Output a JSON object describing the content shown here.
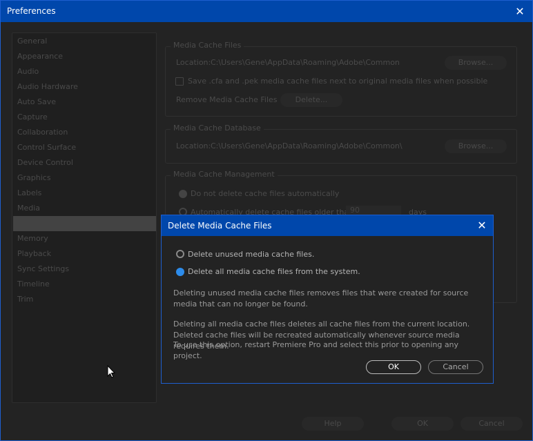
{
  "window": {
    "title": "Preferences"
  },
  "sidebar": {
    "items": [
      "General",
      "Appearance",
      "Audio",
      "Audio Hardware",
      "Auto Save",
      "Capture",
      "Collaboration",
      "Control Surface",
      "Device Control",
      "Graphics",
      "Labels",
      "Media",
      "",
      "Memory",
      "Playback",
      "Sync Settings",
      "Timeline",
      "Trim"
    ],
    "selected_index": 12
  },
  "media_cache_files": {
    "legend": "Media Cache Files",
    "location_label": "Location:",
    "location_value": "C:\\Users\\Gene\\AppData\\Roaming\\Adobe\\Common",
    "browse": "Browse...",
    "save_checkbox": "Save .cfa and .pek media cache files next to original media files when possible",
    "remove_label": "Remove Media Cache Files",
    "delete": "Delete..."
  },
  "media_cache_database": {
    "legend": "Media Cache Database",
    "location_label": "Location:",
    "location_value": "C:\\Users\\Gene\\AppData\\Roaming\\Adobe\\Common\\",
    "browse": "Browse..."
  },
  "media_cache_management": {
    "legend": "Media Cache Management",
    "opt1": "Do not delete cache files automatically",
    "opt2": "Automatically delete cache files older than:",
    "days_value": "90",
    "days_label": "days"
  },
  "footer": {
    "help": "Help",
    "ok": "OK",
    "cancel": "Cancel"
  },
  "dialog": {
    "title": "Delete Media Cache Files",
    "option_unused": "Delete unused media cache files.",
    "option_all": "Delete all media cache files from the system.",
    "selected": "option_all",
    "para1": "Deleting unused media cache files removes files that were created for source media that can no longer be found.",
    "para2": "Deleting all media cache files deletes all cache files from the current location. Deleted cache files will be recreated automatically whenever source media requires them.",
    "para3": "To use this option, restart Premiere Pro and select this prior to opening any project.",
    "ok": "OK",
    "cancel": "Cancel"
  },
  "colors": {
    "accent": "#0047ab",
    "radio_selected": "#2d8ceb"
  }
}
